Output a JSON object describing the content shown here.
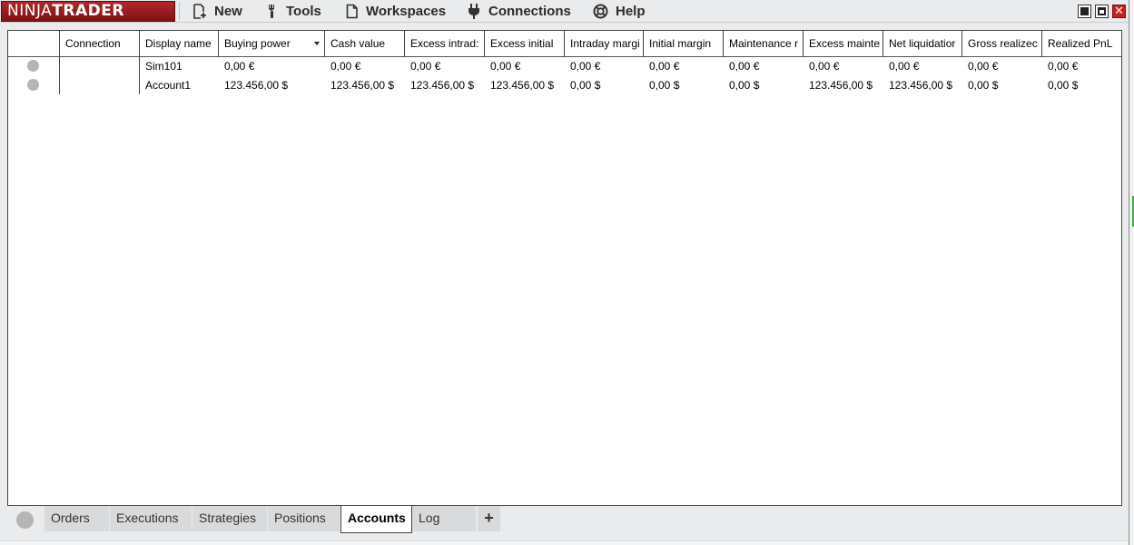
{
  "app": {
    "logo_light": "NINJA",
    "logo_bold": "TRADER"
  },
  "menu": {
    "new": "New",
    "tools": "Tools",
    "workspaces": "Workspaces",
    "connections": "Connections",
    "help": "Help"
  },
  "window_controls": {
    "close_glyph": "✕"
  },
  "grid": {
    "columns": [
      "",
      "Connection",
      "Display name",
      "Buying power",
      "Cash value",
      "Excess intrad:",
      "Excess initial",
      "Intraday margi",
      "Initial margin",
      "Maintenance r",
      "Excess maintе",
      "Net liquidatior",
      "Gross realizec",
      "Realized PnL"
    ],
    "sorted_column": "Buying power",
    "rows": [
      {
        "connection": "",
        "display_name": "Sim101",
        "buying_power": "0,00 €",
        "cash_value": "0,00 €",
        "excess_intraday": "0,00 €",
        "excess_initial": "0,00 €",
        "intraday_margin": "0,00 €",
        "initial_margin": "0,00 €",
        "maintenance_margin": "0,00 €",
        "excess_maintenance": "0,00 €",
        "net_liquidation": "0,00 €",
        "gross_realized": "0,00 €",
        "realized_pnl": "0,00 €"
      },
      {
        "connection": "",
        "display_name": "Account1",
        "buying_power": "123.456,00 $",
        "cash_value": "123.456,00 $",
        "excess_intraday": "123.456,00 $",
        "excess_initial": "123.456,00 $",
        "intraday_margin": "0,00 $",
        "initial_margin": "0,00 $",
        "maintenance_margin": "0,00 $",
        "excess_maintenance": "123.456,00 $",
        "net_liquidation": "123.456,00 $",
        "gross_realized": "0,00 $",
        "realized_pnl": "0,00 $"
      }
    ]
  },
  "tabs": {
    "orders": "Orders",
    "executions": "Executions",
    "strategies": "Strategies",
    "positions": "Positions",
    "accounts": "Accounts",
    "log": "Log",
    "add": "+",
    "active": "Accounts"
  },
  "colors": {
    "logo_red": "#9b1e21",
    "status_dot": "#b5b5b5",
    "chrome": "#e9ebec"
  }
}
